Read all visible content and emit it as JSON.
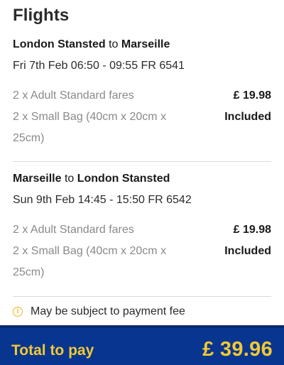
{
  "title": "Flights",
  "flights": [
    {
      "from": "London Stansted",
      "to_word": "to",
      "to": "Marseille",
      "schedule": "Fri 7th Feb 06:50 - 09:55 FR 6541",
      "lines": [
        {
          "label": "2 x Adult Standard fares",
          "value": "£ 19.98"
        },
        {
          "label": "2 x Small Bag (40cm x 20cm x 25cm)",
          "value": "Included"
        }
      ]
    },
    {
      "from": "Marseille",
      "to_word": "to",
      "to": "London Stansted",
      "schedule": "Sun 9th Feb 14:45 - 15:50 FR 6542",
      "lines": [
        {
          "label": "2 x Adult Standard fares",
          "value": "£ 19.98"
        },
        {
          "label": "2 x Small Bag (40cm x 20cm x 25cm)",
          "value": "Included"
        }
      ]
    }
  ],
  "notice": {
    "icon": "info-icon",
    "text": "May be subject to payment fee"
  },
  "total": {
    "label": "Total to pay",
    "amount": "£ 39.96"
  },
  "colors": {
    "total_bar": "#073590",
    "accent_yellow": "#f1c933",
    "muted_text": "#8a8a8a"
  }
}
